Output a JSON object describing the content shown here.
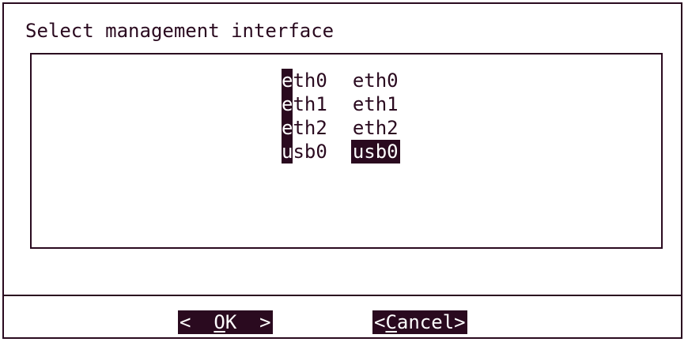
{
  "dialog": {
    "title": "Select management interface"
  },
  "list": {
    "items": [
      {
        "hotkey": "e",
        "tag_rest": "th0",
        "description": "eth0",
        "selected": false
      },
      {
        "hotkey": "e",
        "tag_rest": "th1",
        "description": "eth1",
        "selected": false
      },
      {
        "hotkey": "e",
        "tag_rest": "th2",
        "description": "eth2",
        "selected": false
      },
      {
        "hotkey": "u",
        "tag_rest": "sb0",
        "description": "usb0",
        "selected": true
      }
    ]
  },
  "buttons": {
    "ok": {
      "left": "<  ",
      "hot": "O",
      "rest": "K",
      "right": "  >"
    },
    "cancel": {
      "left": "<",
      "hot": "C",
      "rest": "ancel",
      "right": ">"
    }
  }
}
